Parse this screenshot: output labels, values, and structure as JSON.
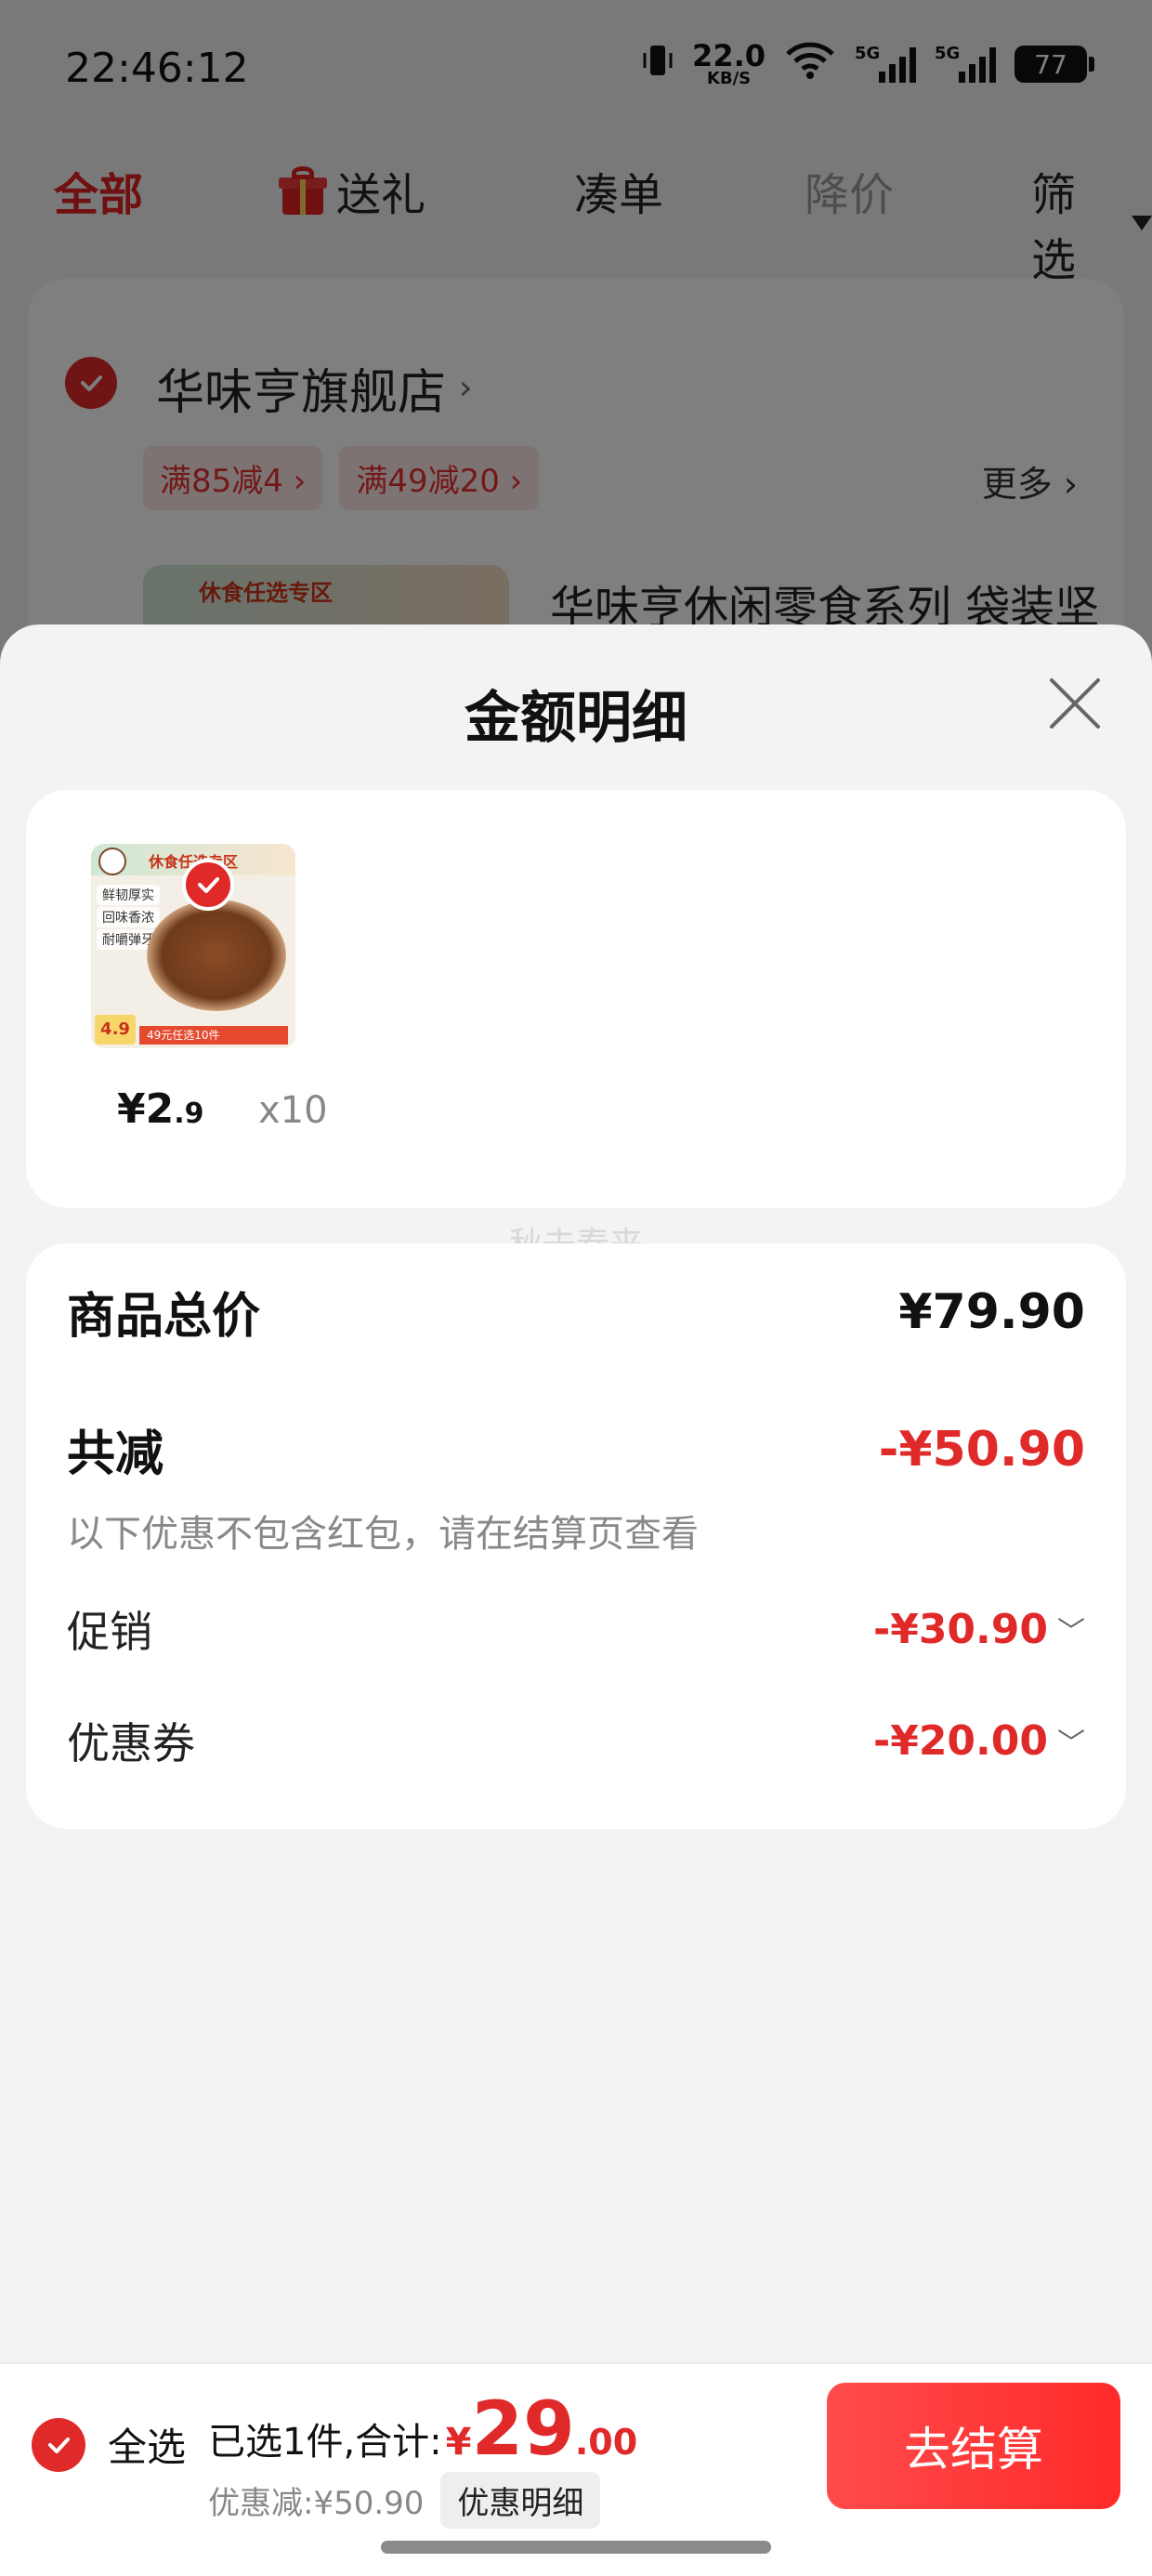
{
  "status_bar": {
    "time": "22:46:12",
    "net_speed_value": "22.0",
    "net_speed_unit": "KB/S",
    "sim1_label": "5G",
    "sim2_label": "5G",
    "battery_level": "77"
  },
  "top_tabs": {
    "all": "全部",
    "gift": "送礼",
    "combine": "凑单",
    "price_drop": "降价",
    "filter": "筛选"
  },
  "store": {
    "name": "华味亨旗舰店",
    "promos": [
      "满85减4",
      "满49减20"
    ],
    "more": "更多",
    "thumb_banner": "休食任选专区",
    "product_title": "华味亨休闲零食系列 袋装坚"
  },
  "sheet": {
    "title": "金额明细",
    "item": {
      "image_banner": "休食任选专区",
      "image_features": [
        "鲜韧厚实",
        "回味香浓",
        "耐嚼弹牙"
      ],
      "image_price": "4.9",
      "image_promo": "49元任选10件",
      "price_symbol": "¥",
      "price_int": "2",
      "price_dec": ".9",
      "quantity": "x10"
    },
    "watermark": "秋去春来",
    "details": {
      "total_label": "商品总价",
      "total_value": "¥79.90",
      "reduce_label": "共减",
      "reduce_value": "-¥50.90",
      "note": "以下优惠不包含红包，请在结算页查看",
      "promo_label": "促销",
      "promo_value": "-¥30.90",
      "coupon_label": "优惠券",
      "coupon_value": "-¥20.00"
    }
  },
  "bottom_bar": {
    "select_all": "全选",
    "selected_text": "已选1件,合计:",
    "total_symbol": "¥",
    "total_int": "29",
    "total_dec": ".00",
    "discount_text": "优惠减:¥50.90",
    "detail_button": "优惠明细",
    "checkout_button": "去结算"
  },
  "colors": {
    "accent_red": "#e02a2a",
    "checkout_gradient_start": "#ff4b4b",
    "sheet_background": "#f3f3f3"
  }
}
